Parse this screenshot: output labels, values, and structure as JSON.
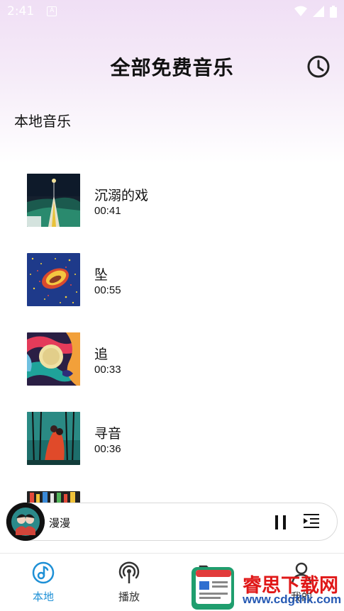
{
  "status_bar": {
    "time": "2:41",
    "notif_letter": "A"
  },
  "header": {
    "title": "全部免费音乐",
    "history_icon": "clock-icon"
  },
  "section": {
    "label": "本地音乐"
  },
  "songs": [
    {
      "title": "沉溺的戏",
      "duration": "00:41"
    },
    {
      "title": "坠",
      "duration": "00:55"
    },
    {
      "title": "追",
      "duration": "00:33"
    },
    {
      "title": "寻音",
      "duration": "00:36"
    }
  ],
  "player": {
    "title": "漫漫",
    "pause_icon": "pause-icon",
    "playlist_icon": "playlist-icon"
  },
  "nav": {
    "items": [
      {
        "label": "本地",
        "icon": "music-note-icon",
        "active": true
      },
      {
        "label": "播放",
        "icon": "broadcast-icon",
        "active": false
      },
      {
        "label": "",
        "icon": "folder-icon",
        "active": false
      },
      {
        "label": "我的",
        "icon": "user-icon",
        "active": false
      }
    ],
    "active_color": "#1e90d6",
    "inactive_color": "#333333"
  },
  "watermark": {
    "text": "睿思下载网",
    "url": "www.cdgthk.com"
  }
}
